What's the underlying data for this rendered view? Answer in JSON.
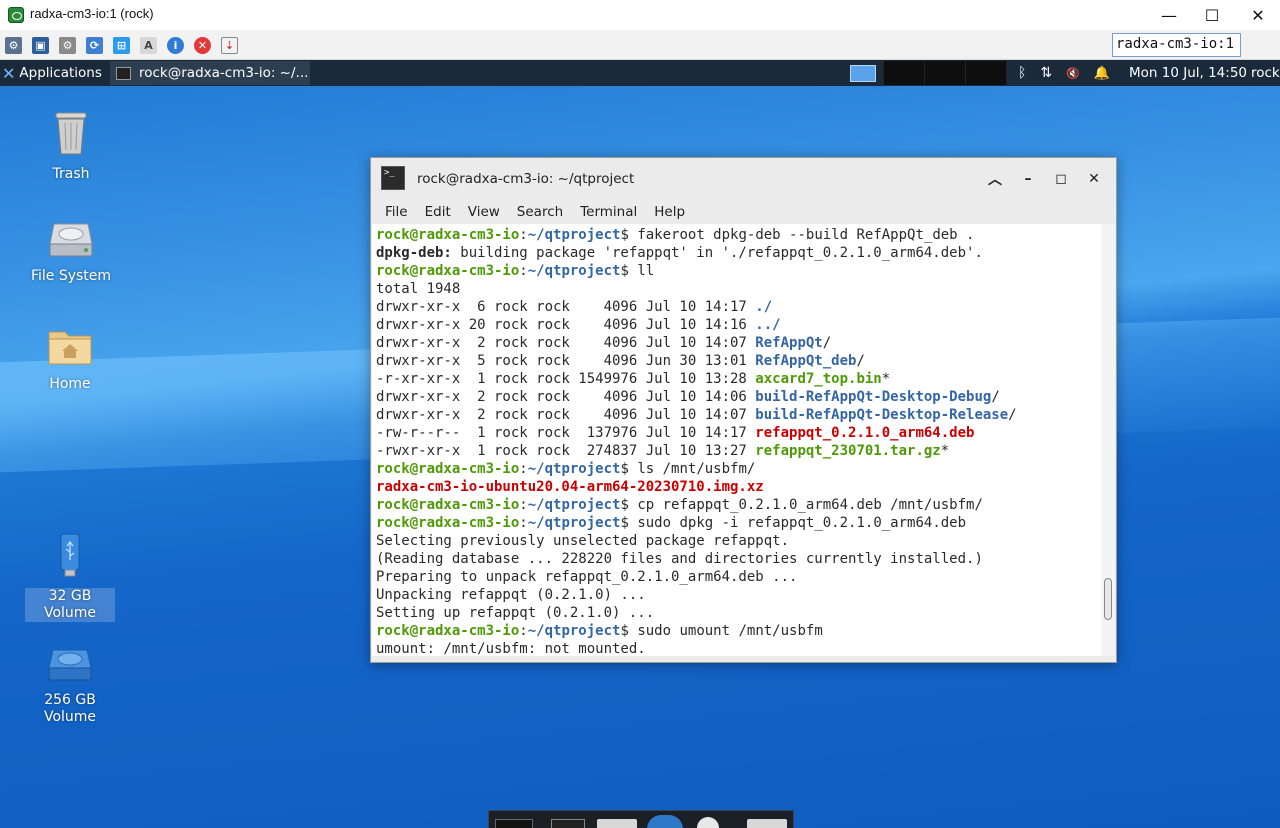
{
  "vnc": {
    "title": "radxa-cm3-io:1 (rock)",
    "host_field": "radxa-cm3-io:1",
    "controls": {
      "minimize": "—",
      "maximize": "☐",
      "close": "✕"
    }
  },
  "panel": {
    "applications_label": "Applications",
    "task_label": "rock@radxa-cm3-io: ~/...",
    "clock": "Mon 10 Jul, 14:50",
    "user": "rock"
  },
  "desktop_icons": [
    {
      "label": "Trash",
      "icon": "trash-icon"
    },
    {
      "label": "File System",
      "icon": "harddisk-icon"
    },
    {
      "label": "Home",
      "icon": "home-folder-icon"
    },
    {
      "label": "32 GB\nVolume",
      "icon": "usb-drive-icon"
    },
    {
      "label": "256 GB\nVolume",
      "icon": "disk-volume-icon"
    }
  ],
  "terminal": {
    "title": "rock@radxa-cm3-io: ~/qtproject",
    "menu": [
      "File",
      "Edit",
      "View",
      "Search",
      "Terminal",
      "Help"
    ],
    "prompt_user": "rock@radxa-cm3-io",
    "prompt_path": "~/qtproject",
    "lines": [
      {
        "type": "cmd",
        "text": "fakeroot dpkg-deb --build RefAppQt_deb ."
      },
      {
        "type": "labeled",
        "label": "dpkg-deb:",
        "text": " building package 'refappqt' in './refappqt_0.2.1.0_arm64.deb'."
      },
      {
        "type": "cmd",
        "text": "ll"
      },
      {
        "type": "out",
        "text": "total 1948"
      },
      {
        "type": "ls",
        "meta": "drwxr-xr-x  6 rock rock    4096 Jul 10 14:17 ",
        "name": "./",
        "cls": "dir",
        "suffix": ""
      },
      {
        "type": "ls",
        "meta": "drwxr-xr-x 20 rock rock    4096 Jul 10 14:16 ",
        "name": "../",
        "cls": "dir",
        "suffix": ""
      },
      {
        "type": "ls",
        "meta": "drwxr-xr-x  2 rock rock    4096 Jul 10 14:07 ",
        "name": "RefAppQt",
        "cls": "dir",
        "suffix": "/"
      },
      {
        "type": "ls",
        "meta": "drwxr-xr-x  5 rock rock    4096 Jun 30 13:01 ",
        "name": "RefAppQt_deb",
        "cls": "dir",
        "suffix": "/"
      },
      {
        "type": "ls",
        "meta": "-r-xr-xr-x  1 rock rock 1549976 Jul 10 13:28 ",
        "name": "axcard7_top.bin",
        "cls": "exe",
        "suffix": "*"
      },
      {
        "type": "ls",
        "meta": "drwxr-xr-x  2 rock rock    4096 Jul 10 14:06 ",
        "name": "build-RefAppQt-Desktop-Debug",
        "cls": "dir",
        "suffix": "/"
      },
      {
        "type": "ls",
        "meta": "drwxr-xr-x  2 rock rock    4096 Jul 10 14:07 ",
        "name": "build-RefAppQt-Desktop-Release",
        "cls": "dir",
        "suffix": "/"
      },
      {
        "type": "ls",
        "meta": "-rw-r--r--  1 rock rock  137976 Jul 10 14:17 ",
        "name": "refappqt_0.2.1.0_arm64.deb",
        "cls": "deb",
        "suffix": ""
      },
      {
        "type": "ls",
        "meta": "-rwxr-xr-x  1 rock rock  274837 Jul 10 13:27 ",
        "name": "refappqt_230701.tar.gz",
        "cls": "exe",
        "suffix": "*"
      },
      {
        "type": "cmd",
        "text": "ls /mnt/usbfm/"
      },
      {
        "type": "archive",
        "text": "radxa-cm3-io-ubuntu20.04-arm64-20230710.img.xz"
      },
      {
        "type": "cmd",
        "text": "cp refappqt_0.2.1.0_arm64.deb /mnt/usbfm/"
      },
      {
        "type": "cmd",
        "text": "sudo dpkg -i refappqt_0.2.1.0_arm64.deb"
      },
      {
        "type": "out",
        "text": "Selecting previously unselected package refappqt."
      },
      {
        "type": "out",
        "text": "(Reading database ... 228220 files and directories currently installed.)"
      },
      {
        "type": "out",
        "text": "Preparing to unpack refappqt_0.2.1.0_arm64.deb ..."
      },
      {
        "type": "out",
        "text": "Unpacking refappqt (0.2.1.0) ..."
      },
      {
        "type": "out",
        "text": "Setting up refappqt (0.2.1.0) ..."
      },
      {
        "type": "cmd",
        "text": "sudo umount /mnt/usbfm"
      },
      {
        "type": "out",
        "text": "umount: /mnt/usbfm: not mounted."
      }
    ]
  }
}
